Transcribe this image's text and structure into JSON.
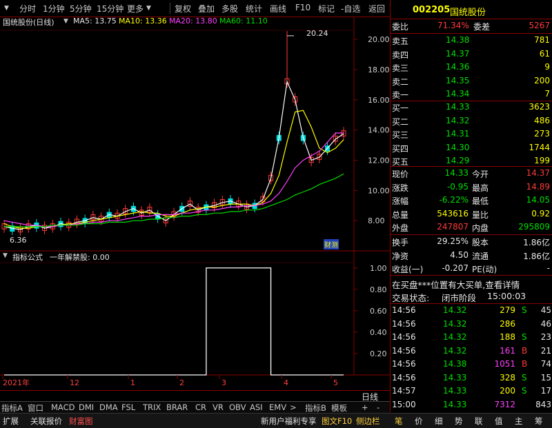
{
  "toolbar": {
    "items": [
      "分时",
      "1分钟",
      "5分钟",
      "15分钟",
      "更多",
      "复权",
      "叠加",
      "多股",
      "统计",
      "画线",
      "F10",
      "标记",
      "-自选",
      "返回"
    ]
  },
  "stock": {
    "code": "002205",
    "name": "国统股份"
  },
  "kline": {
    "title": "国统股份(日线)",
    "ma5": "MA5: 13.75",
    "ma10": "MA10: 13.36",
    "ma20": "MA20: 13.80",
    "ma60": "MA60: 11.10",
    "y_ticks": [
      "20.00",
      "18.00",
      "16.00",
      "14.00",
      "12.00",
      "10.00",
      "8.00"
    ],
    "high_label": "20.24",
    "low_label": "6.36",
    "badge": "财测"
  },
  "indicator": {
    "title": "指标公式",
    "formula": "一年解禁股: 0.00",
    "y_ticks": [
      "1.00",
      "0.80",
      "0.60",
      "0.40",
      "0.20"
    ]
  },
  "xaxis": {
    "labels": [
      "2021年",
      "12",
      "1",
      "2",
      "3",
      "4",
      "5"
    ],
    "period": "日线"
  },
  "chart_data": [
    {
      "type": "line",
      "title": "国统股份(日线)",
      "ylim": [
        6.0,
        20.6
      ],
      "series": [
        {
          "name": "MA5",
          "values": [
            7.6,
            7.5,
            7.4,
            7.6,
            7.7,
            7.5,
            7.6,
            7.8,
            7.7,
            7.9,
            8.0,
            8.2,
            8.1,
            8.4,
            8.3,
            8.6,
            8.8,
            8.5,
            8.7,
            8.3,
            8.0,
            8.4,
            8.8,
            9.1,
            8.7,
            8.9,
            9.0,
            9.2,
            9.3,
            9.1,
            8.9,
            9.0,
            9.4,
            10.8,
            13.5,
            17.2,
            16.0,
            13.5,
            12.0,
            12.2,
            12.8,
            13.4,
            13.75
          ]
        },
        {
          "name": "MA10",
          "values": [
            7.8,
            7.6,
            7.5,
            7.5,
            7.6,
            7.6,
            7.6,
            7.7,
            7.8,
            7.8,
            7.9,
            8.0,
            8.1,
            8.2,
            8.3,
            8.4,
            8.5,
            8.6,
            8.5,
            8.5,
            8.3,
            8.3,
            8.5,
            8.7,
            8.8,
            8.9,
            8.9,
            9.0,
            9.1,
            9.1,
            9.1,
            9.0,
            9.2,
            9.8,
            11.0,
            13.2,
            15.2,
            15.3,
            14.2,
            12.8,
            12.5,
            12.8,
            13.36
          ]
        },
        {
          "name": "MA20",
          "values": [
            8.0,
            7.9,
            7.8,
            7.7,
            7.7,
            7.6,
            7.6,
            7.7,
            7.7,
            7.8,
            7.8,
            7.9,
            7.9,
            8.0,
            8.0,
            8.1,
            8.2,
            8.3,
            8.3,
            8.4,
            8.4,
            8.4,
            8.5,
            8.5,
            8.6,
            8.7,
            8.7,
            8.8,
            8.9,
            8.9,
            9.0,
            9.0,
            9.1,
            9.3,
            9.8,
            10.6,
            11.5,
            12.0,
            12.3,
            12.6,
            13.2,
            13.8,
            13.8
          ]
        },
        {
          "name": "MA60",
          "values": [
            7.6,
            7.6,
            7.6,
            7.6,
            7.6,
            7.6,
            7.7,
            7.7,
            7.7,
            7.7,
            7.8,
            7.8,
            7.8,
            7.9,
            7.9,
            7.9,
            8.0,
            8.0,
            8.1,
            8.1,
            8.2,
            8.2,
            8.3,
            8.3,
            8.4,
            8.4,
            8.5,
            8.5,
            8.6,
            8.6,
            8.7,
            8.7,
            8.8,
            9.0,
            9.2,
            9.4,
            9.7,
            9.9,
            10.1,
            10.4,
            10.6,
            10.8,
            11.1
          ]
        }
      ]
    },
    {
      "type": "line",
      "title": "一年解禁股: 0.00",
      "ylim": [
        0,
        1.05
      ],
      "series": [
        {
          "values": [
            0,
            0,
            0,
            0,
            0,
            0,
            0,
            0,
            0,
            0,
            0,
            0,
            0,
            0,
            0,
            0,
            0,
            0,
            0,
            0,
            0,
            0,
            0,
            0,
            0,
            1,
            1,
            1,
            1,
            1,
            1,
            1,
            1,
            0,
            0,
            0,
            0,
            0,
            0,
            0,
            0,
            0,
            0
          ]
        }
      ]
    }
  ],
  "panel": {
    "weibi": {
      "label": "委比",
      "value": "71.34%",
      "label2": "委差",
      "value2": "5267"
    },
    "asks": [
      {
        "label": "卖五",
        "price": "14.38",
        "vol": "781"
      },
      {
        "label": "卖四",
        "price": "14.37",
        "vol": "61"
      },
      {
        "label": "卖三",
        "price": "14.36",
        "vol": "9"
      },
      {
        "label": "卖二",
        "price": "14.35",
        "vol": "200"
      },
      {
        "label": "卖一",
        "price": "14.34",
        "vol": "7"
      }
    ],
    "bids": [
      {
        "label": "买一",
        "price": "14.33",
        "vol": "3623"
      },
      {
        "label": "买二",
        "price": "14.32",
        "vol": "486"
      },
      {
        "label": "买三",
        "price": "14.31",
        "vol": "273"
      },
      {
        "label": "买四",
        "price": "14.30",
        "vol": "1744"
      },
      {
        "label": "买五",
        "price": "14.29",
        "vol": "199"
      }
    ],
    "quote": [
      {
        "l1": "现价",
        "v1": "14.33",
        "l2": "今开",
        "v2": "14.37"
      },
      {
        "l1": "涨跌",
        "v1": "-0.95",
        "l2": "最高",
        "v2": "14.89"
      },
      {
        "l1": "涨幅",
        "v1": "-6.22%",
        "l2": "最低",
        "v2": "14.05"
      },
      {
        "l1": "总量",
        "v1": "543616",
        "l2": "量比",
        "v2": "0.92"
      },
      {
        "l1": "外盘",
        "v1": "247807",
        "l2": "内盘",
        "v2": "295809"
      }
    ],
    "stats": [
      {
        "l1": "换手",
        "v1": "29.25%",
        "l2": "股本",
        "v2": "1.86亿"
      },
      {
        "l1": "净资",
        "v1": "4.50",
        "l2": "流通",
        "v2": "1.86亿"
      },
      {
        "l1": "收益(一)",
        "v1": "-0.207",
        "l2": "PE(动)",
        "v2": "-"
      }
    ],
    "notice": "在买盘***位置有大买单,查看详情",
    "trade_status_label": "交易状态:",
    "trade_status_value": "闭市阶段",
    "trade_time": "15:00:03",
    "ticks": [
      {
        "time": "14:56",
        "price": "14.32",
        "vol": "279",
        "bs": "S",
        "n": "45"
      },
      {
        "time": "14:56",
        "price": "14.32",
        "vol": "286",
        "bs": "",
        "n": "46"
      },
      {
        "time": "14:56",
        "price": "14.32",
        "vol": "188",
        "bs": "S",
        "n": "23"
      },
      {
        "time": "14:56",
        "price": "14.32",
        "vol": "161",
        "bs": "B",
        "n": "21"
      },
      {
        "time": "14:56",
        "price": "14.38",
        "vol": "1051",
        "bs": "B",
        "n": "74"
      },
      {
        "time": "14:56",
        "price": "14.33",
        "vol": "328",
        "bs": "S",
        "n": "15"
      },
      {
        "time": "14:57",
        "price": "14.33",
        "vol": "200",
        "bs": "S",
        "n": "17"
      },
      {
        "time": "15:00",
        "price": "14.33",
        "vol": "7312",
        "bs": "",
        "n": "843"
      }
    ]
  },
  "bottom_tabs": [
    "指标A",
    "窗口",
    "MACD",
    "DMI",
    "DMA",
    "FSL",
    "TRIX",
    "BRAR",
    "CR",
    "VR",
    "OBV",
    "ASI",
    "EMV",
    ">",
    "指标B",
    "模板",
    "+",
    "-"
  ],
  "statusbar": {
    "left": [
      "扩展",
      "关联报价",
      "财富图"
    ],
    "center": "新用户福利专享",
    "mid": [
      "图文F10",
      "侧边栏"
    ],
    "right": [
      "笔",
      "价",
      "细",
      "势",
      "联",
      "值",
      "主",
      "筹"
    ]
  },
  "colors": {
    "up": "#ff3b3b",
    "down": "#00e000",
    "frame": "#8a0000",
    "ma5": "#ffffff",
    "ma10": "#ffff00",
    "ma20": "#ff40ff",
    "ma60": "#00e000"
  }
}
